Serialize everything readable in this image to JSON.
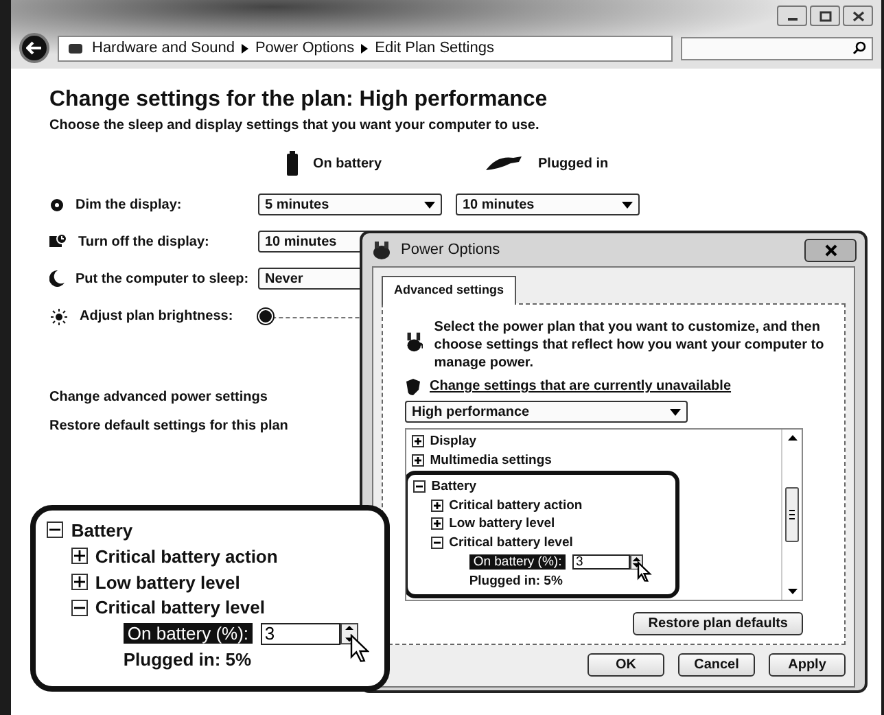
{
  "window": {
    "breadcrumb": [
      "Hardware and Sound",
      "Power Options",
      "Edit Plan Settings"
    ]
  },
  "heading": "Change settings for the plan: High performance",
  "subheading": "Choose the sleep and display settings that you want your computer to use.",
  "columns": [
    "On battery",
    "Plugged in"
  ],
  "settings": [
    {
      "kind": "dropdown",
      "label": "Dim the display:",
      "values": [
        "5 minutes",
        "10 minutes"
      ]
    },
    {
      "kind": "dropdown",
      "label": "Turn off the display:",
      "values": [
        "10 minutes"
      ]
    },
    {
      "kind": "dropdown",
      "label": "Put the computer to sleep:",
      "values": [
        "Never"
      ]
    },
    {
      "kind": "slider",
      "label": "Adjust plan brightness:",
      "level": 0
    }
  ],
  "links": [
    "Change advanced power settings",
    "Restore default settings for this plan"
  ],
  "dialog": {
    "title": "Power Options",
    "tabs": [
      {
        "label": "Advanced settings",
        "selected": true
      }
    ],
    "intro": "Select the power plan that you want to customize, and then choose settings that reflect how you want your computer to manage power.",
    "link": "Change settings that are currently unavailable",
    "plan": "High performance",
    "tree": [
      {
        "label": "Display",
        "expanded": false
      },
      {
        "label": "Multimedia settings",
        "expanded": false
      },
      {
        "label": "Battery",
        "expanded": true,
        "children": [
          {
            "label": "Critical battery action",
            "expanded": false
          },
          {
            "label": "Low battery level",
            "expanded": false
          },
          {
            "label": "Critical battery level",
            "expanded": true,
            "children": [
              {
                "kind": "spin",
                "label": "On battery (%):",
                "value": "3",
                "selected": true
              },
              {
                "kind": "text",
                "label": "Plugged in: 5%"
              }
            ]
          }
        ]
      }
    ],
    "buttons": [
      "Restore plan defaults",
      "OK",
      "Cancel",
      "Apply"
    ]
  },
  "callout": {
    "tree": [
      {
        "label": "Battery",
        "expanded": true,
        "children": [
          {
            "label": "Critical battery action",
            "expanded": false
          },
          {
            "label": "Low battery level",
            "expanded": false
          },
          {
            "label": "Critical battery level",
            "expanded": true,
            "children": [
              {
                "kind": "spin",
                "label": "On battery (%):",
                "value": "3",
                "selected": true
              },
              {
                "kind": "text",
                "label": "Plugged in: 5%"
              }
            ]
          }
        ]
      }
    ]
  }
}
